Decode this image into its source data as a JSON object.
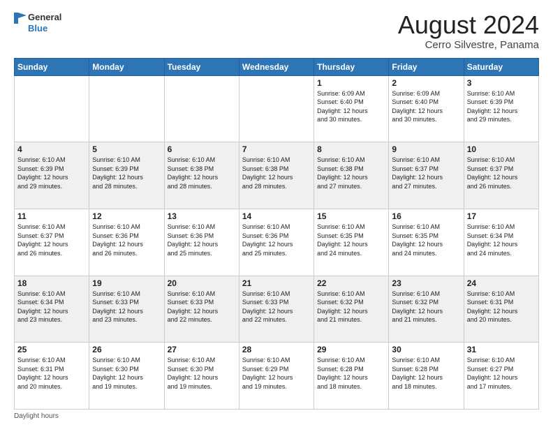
{
  "logo": {
    "text_general": "General",
    "text_blue": "Blue"
  },
  "title": "August 2024",
  "subtitle": "Cerro Silvestre, Panama",
  "days_of_week": [
    "Sunday",
    "Monday",
    "Tuesday",
    "Wednesday",
    "Thursday",
    "Friday",
    "Saturday"
  ],
  "weeks": [
    [
      {
        "day": "",
        "info": ""
      },
      {
        "day": "",
        "info": ""
      },
      {
        "day": "",
        "info": ""
      },
      {
        "day": "",
        "info": ""
      },
      {
        "day": "1",
        "info": "Sunrise: 6:09 AM\nSunset: 6:40 PM\nDaylight: 12 hours\nand 30 minutes."
      },
      {
        "day": "2",
        "info": "Sunrise: 6:09 AM\nSunset: 6:40 PM\nDaylight: 12 hours\nand 30 minutes."
      },
      {
        "day": "3",
        "info": "Sunrise: 6:10 AM\nSunset: 6:39 PM\nDaylight: 12 hours\nand 29 minutes."
      }
    ],
    [
      {
        "day": "4",
        "info": "Sunrise: 6:10 AM\nSunset: 6:39 PM\nDaylight: 12 hours\nand 29 minutes."
      },
      {
        "day": "5",
        "info": "Sunrise: 6:10 AM\nSunset: 6:39 PM\nDaylight: 12 hours\nand 28 minutes."
      },
      {
        "day": "6",
        "info": "Sunrise: 6:10 AM\nSunset: 6:38 PM\nDaylight: 12 hours\nand 28 minutes."
      },
      {
        "day": "7",
        "info": "Sunrise: 6:10 AM\nSunset: 6:38 PM\nDaylight: 12 hours\nand 28 minutes."
      },
      {
        "day": "8",
        "info": "Sunrise: 6:10 AM\nSunset: 6:38 PM\nDaylight: 12 hours\nand 27 minutes."
      },
      {
        "day": "9",
        "info": "Sunrise: 6:10 AM\nSunset: 6:37 PM\nDaylight: 12 hours\nand 27 minutes."
      },
      {
        "day": "10",
        "info": "Sunrise: 6:10 AM\nSunset: 6:37 PM\nDaylight: 12 hours\nand 26 minutes."
      }
    ],
    [
      {
        "day": "11",
        "info": "Sunrise: 6:10 AM\nSunset: 6:37 PM\nDaylight: 12 hours\nand 26 minutes."
      },
      {
        "day": "12",
        "info": "Sunrise: 6:10 AM\nSunset: 6:36 PM\nDaylight: 12 hours\nand 26 minutes."
      },
      {
        "day": "13",
        "info": "Sunrise: 6:10 AM\nSunset: 6:36 PM\nDaylight: 12 hours\nand 25 minutes."
      },
      {
        "day": "14",
        "info": "Sunrise: 6:10 AM\nSunset: 6:36 PM\nDaylight: 12 hours\nand 25 minutes."
      },
      {
        "day": "15",
        "info": "Sunrise: 6:10 AM\nSunset: 6:35 PM\nDaylight: 12 hours\nand 24 minutes."
      },
      {
        "day": "16",
        "info": "Sunrise: 6:10 AM\nSunset: 6:35 PM\nDaylight: 12 hours\nand 24 minutes."
      },
      {
        "day": "17",
        "info": "Sunrise: 6:10 AM\nSunset: 6:34 PM\nDaylight: 12 hours\nand 24 minutes."
      }
    ],
    [
      {
        "day": "18",
        "info": "Sunrise: 6:10 AM\nSunset: 6:34 PM\nDaylight: 12 hours\nand 23 minutes."
      },
      {
        "day": "19",
        "info": "Sunrise: 6:10 AM\nSunset: 6:33 PM\nDaylight: 12 hours\nand 23 minutes."
      },
      {
        "day": "20",
        "info": "Sunrise: 6:10 AM\nSunset: 6:33 PM\nDaylight: 12 hours\nand 22 minutes."
      },
      {
        "day": "21",
        "info": "Sunrise: 6:10 AM\nSunset: 6:33 PM\nDaylight: 12 hours\nand 22 minutes."
      },
      {
        "day": "22",
        "info": "Sunrise: 6:10 AM\nSunset: 6:32 PM\nDaylight: 12 hours\nand 21 minutes."
      },
      {
        "day": "23",
        "info": "Sunrise: 6:10 AM\nSunset: 6:32 PM\nDaylight: 12 hours\nand 21 minutes."
      },
      {
        "day": "24",
        "info": "Sunrise: 6:10 AM\nSunset: 6:31 PM\nDaylight: 12 hours\nand 20 minutes."
      }
    ],
    [
      {
        "day": "25",
        "info": "Sunrise: 6:10 AM\nSunset: 6:31 PM\nDaylight: 12 hours\nand 20 minutes."
      },
      {
        "day": "26",
        "info": "Sunrise: 6:10 AM\nSunset: 6:30 PM\nDaylight: 12 hours\nand 19 minutes."
      },
      {
        "day": "27",
        "info": "Sunrise: 6:10 AM\nSunset: 6:30 PM\nDaylight: 12 hours\nand 19 minutes."
      },
      {
        "day": "28",
        "info": "Sunrise: 6:10 AM\nSunset: 6:29 PM\nDaylight: 12 hours\nand 19 minutes."
      },
      {
        "day": "29",
        "info": "Sunrise: 6:10 AM\nSunset: 6:28 PM\nDaylight: 12 hours\nand 18 minutes."
      },
      {
        "day": "30",
        "info": "Sunrise: 6:10 AM\nSunset: 6:28 PM\nDaylight: 12 hours\nand 18 minutes."
      },
      {
        "day": "31",
        "info": "Sunrise: 6:10 AM\nSunset: 6:27 PM\nDaylight: 12 hours\nand 17 minutes."
      }
    ]
  ],
  "footer": "Daylight hours"
}
